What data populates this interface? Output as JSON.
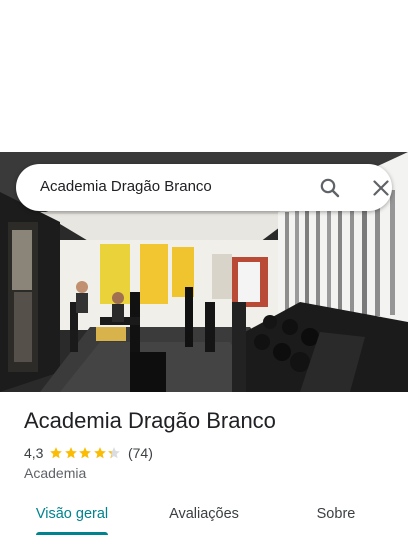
{
  "search": {
    "query": "Academia Dragão Branco",
    "search_icon": "search-icon",
    "close_icon": "close-icon"
  },
  "place": {
    "name": "Academia Dragão Branco",
    "rating": "4,3",
    "rating_stars": 4.3,
    "review_count": "(74)",
    "category": "Academia"
  },
  "tabs": [
    {
      "label": "Visão geral",
      "active": true
    },
    {
      "label": "Avaliações",
      "active": false
    },
    {
      "label": "Sobre",
      "active": false
    }
  ],
  "colors": {
    "accent": "#00838f",
    "star": "#fbbc04",
    "star_empty": "#dadce0"
  }
}
